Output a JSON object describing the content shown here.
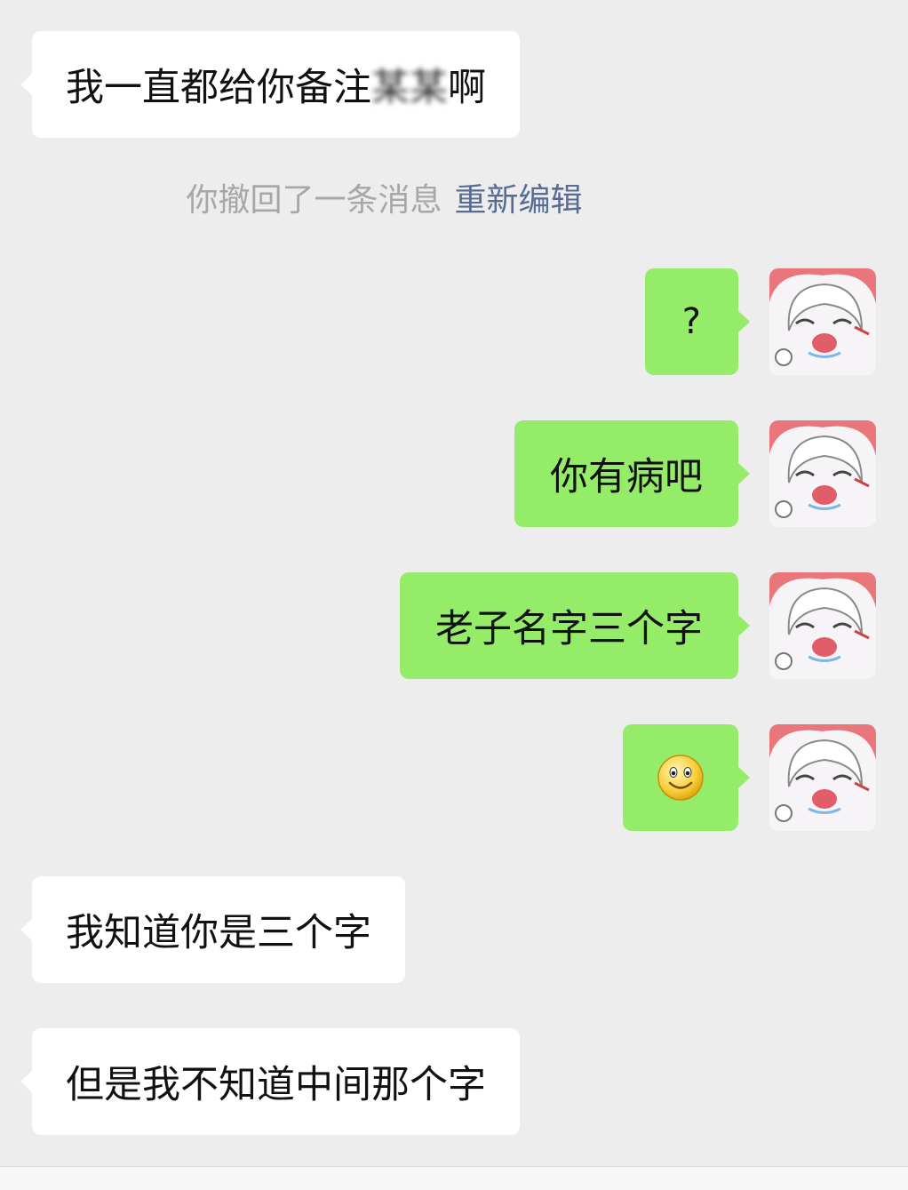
{
  "chat": {
    "messages": [
      {
        "side": "in",
        "text_before": "我一直都给你备注",
        "text_hidden": "某某",
        "text_after": "啊"
      },
      {
        "side": "out",
        "text": "?"
      },
      {
        "side": "out",
        "text": "你有病吧"
      },
      {
        "side": "out",
        "text": "老子名字三个字"
      },
      {
        "side": "out",
        "emoji": "smiley-emoji"
      },
      {
        "side": "in",
        "text": "我知道你是三个字"
      },
      {
        "side": "in",
        "text": "但是我不知道中间那个字"
      }
    ],
    "recall_notice": {
      "text": "你撤回了一条消息",
      "action": "重新编辑"
    },
    "avatar_icon": "anime-girl-avatar",
    "colors": {
      "background": "#ededed",
      "incoming_bubble": "#ffffff",
      "outgoing_bubble": "#95ec69",
      "link": "#576b95",
      "system_text": "#a7a7a7"
    }
  }
}
